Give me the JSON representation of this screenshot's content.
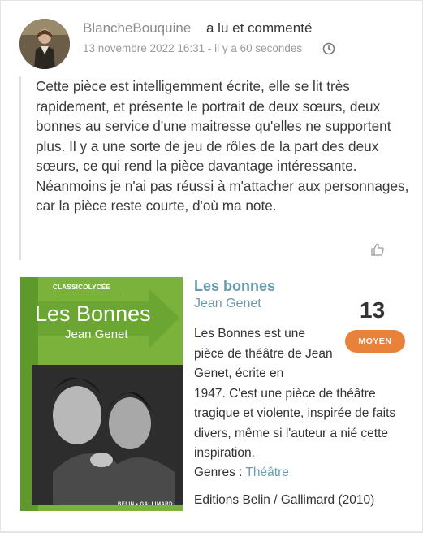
{
  "header": {
    "username": "BlancheBouquine",
    "action": "a lu et commenté",
    "timestamp": "13 novembre 2022 16:31 - il y a 60 secondes"
  },
  "review": {
    "text": "Cette pièce est intelligemment écrite, elle se lit très rapidement, et présente le portrait de deux sœurs, deux bonnes au service d'une maitresse qu'elles ne supportent plus. Il y a une sorte de jeu de rôles de la part des deux sœurs, ce qui rend la pièce davantage intéressante. Néanmoins je n'ai pas réussi à m'attacher aux personnages, car la pièce reste courte, d'où ma note."
  },
  "book": {
    "title": "Les bonnes",
    "author": "Jean Genet",
    "score": "13",
    "score_label": "MOYEN",
    "summary_part1": "Les Bonnes est une pièce de théâtre de Jean Genet, écrite en",
    "summary_part2": "1947. C'est une pièce de théâtre tragique et violente, inspirée de faits divers, même si l'auteur a nié cette inspiration.",
    "genres_label": "Genres : ",
    "genre": "Théâtre",
    "edition": "Editions Belin / Gallimard (2010)",
    "cover": {
      "series": "CLASSICOLYCÉE",
      "title": "Les Bonnes",
      "author": "Jean Genet",
      "publisher": "BELIN ▪ GALLIMARD"
    }
  },
  "colors": {
    "link": "#6a9aac",
    "badge": "#e8823a",
    "cover_green": "#7ab23c"
  },
  "icons": {
    "clock": "clock-icon",
    "like": "thumbs-up-icon"
  }
}
